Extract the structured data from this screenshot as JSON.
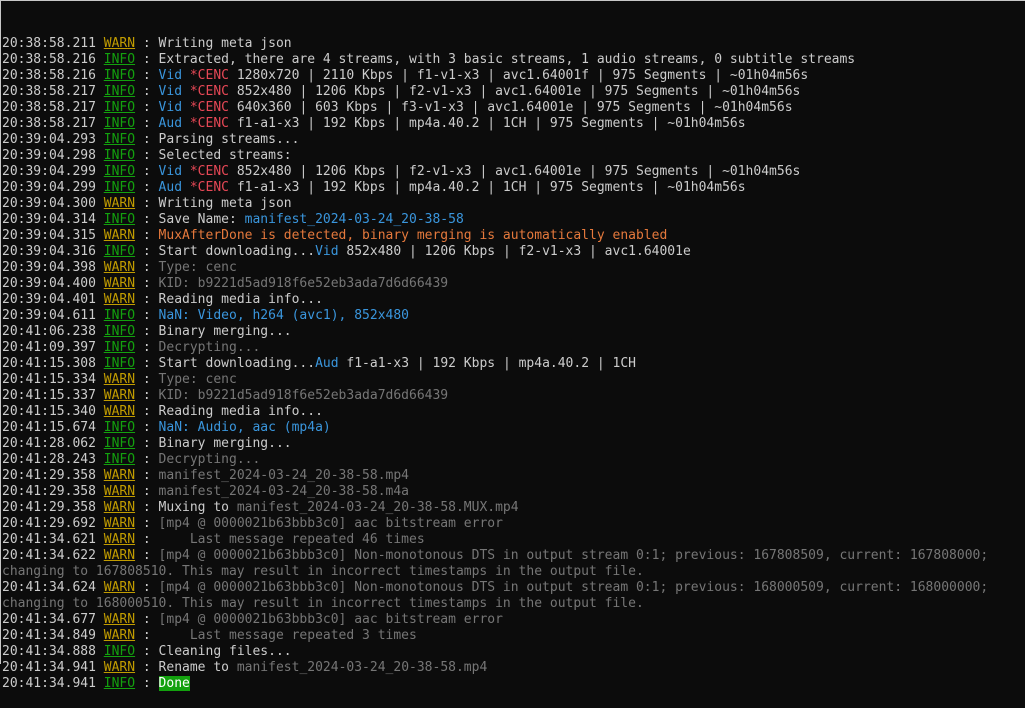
{
  "colors": {
    "background": "#0c0c0c",
    "text": "#cccccc",
    "warn": "#c19c00",
    "info": "#13a10e",
    "dim": "#767676",
    "cyan": "#3a96dd",
    "red": "#e74856",
    "orange": "#e5793c",
    "done_highlight": "#13a10e"
  },
  "lines": [
    {
      "time": "20:38:58.211",
      "level": "WARN",
      "parts": [
        {
          "t": "Writing meta json",
          "c": "default"
        }
      ]
    },
    {
      "time": "20:38:58.216",
      "level": "INFO",
      "parts": [
        {
          "t": "Extracted, there are 4 streams, with 3 basic streams, 1 audio streams, 0 subtitle streams",
          "c": "default"
        }
      ]
    },
    {
      "time": "20:38:58.216",
      "level": "INFO",
      "parts": [
        {
          "t": "Vid ",
          "c": "cyan"
        },
        {
          "t": "*CENC",
          "c": "red"
        },
        {
          "t": " 1280x720 | 2110 Kbps | f1-v1-x3 | avc1.64001f | 975 Segments | ~01h04m56s",
          "c": "default"
        }
      ]
    },
    {
      "time": "20:38:58.217",
      "level": "INFO",
      "parts": [
        {
          "t": "Vid ",
          "c": "cyan"
        },
        {
          "t": "*CENC",
          "c": "red"
        },
        {
          "t": " 852x480 | 1206 Kbps | f2-v1-x3 | avc1.64001e | 975 Segments | ~01h04m56s",
          "c": "default"
        }
      ]
    },
    {
      "time": "20:38:58.217",
      "level": "INFO",
      "parts": [
        {
          "t": "Vid ",
          "c": "cyan"
        },
        {
          "t": "*CENC",
          "c": "red"
        },
        {
          "t": " 640x360 | 603 Kbps | f3-v1-x3 | avc1.64001e | 975 Segments | ~01h04m56s",
          "c": "default"
        }
      ]
    },
    {
      "time": "20:38:58.217",
      "level": "INFO",
      "parts": [
        {
          "t": "Aud ",
          "c": "cyan"
        },
        {
          "t": "*CENC",
          "c": "red"
        },
        {
          "t": " f1-a1-x3 | 192 Kbps | mp4a.40.2 | 1CH | 975 Segments | ~01h04m56s",
          "c": "default"
        }
      ]
    },
    {
      "time": "20:39:04.293",
      "level": "INFO",
      "parts": [
        {
          "t": "Parsing streams...",
          "c": "default"
        }
      ]
    },
    {
      "time": "20:39:04.298",
      "level": "INFO",
      "parts": [
        {
          "t": "Selected streams:",
          "c": "default"
        }
      ]
    },
    {
      "time": "20:39:04.299",
      "level": "INFO",
      "parts": [
        {
          "t": "Vid ",
          "c": "cyan"
        },
        {
          "t": "*CENC",
          "c": "red"
        },
        {
          "t": " 852x480 | 1206 Kbps | f2-v1-x3 | avc1.64001e | 975 Segments | ~01h04m56s",
          "c": "default"
        }
      ]
    },
    {
      "time": "20:39:04.299",
      "level": "INFO",
      "parts": [
        {
          "t": "Aud ",
          "c": "cyan"
        },
        {
          "t": "*CENC",
          "c": "red"
        },
        {
          "t": " f1-a1-x3 | 192 Kbps | mp4a.40.2 | 1CH | 975 Segments | ~01h04m56s",
          "c": "default"
        }
      ]
    },
    {
      "time": "20:39:04.300",
      "level": "WARN",
      "parts": [
        {
          "t": "Writing meta json",
          "c": "default"
        }
      ]
    },
    {
      "time": "20:39:04.314",
      "level": "INFO",
      "parts": [
        {
          "t": "Save Name: ",
          "c": "default"
        },
        {
          "t": "manifest_2024-03-24_20-38-58",
          "c": "cyan"
        }
      ]
    },
    {
      "time": "20:39:04.315",
      "level": "WARN",
      "parts": [
        {
          "t": "MuxAfterDone is detected, binary merging is automatically enabled",
          "c": "orange"
        }
      ]
    },
    {
      "time": "20:39:04.316",
      "level": "INFO",
      "parts": [
        {
          "t": "Start downloading...",
          "c": "default"
        },
        {
          "t": "Vid",
          "c": "cyan"
        },
        {
          "t": " 852x480 | 1206 Kbps | f2-v1-x3 | avc1.64001e",
          "c": "default"
        }
      ]
    },
    {
      "time": "20:39:04.398",
      "level": "WARN",
      "parts": [
        {
          "t": "Type: cenc",
          "c": "gray"
        }
      ]
    },
    {
      "time": "20:39:04.400",
      "level": "WARN",
      "parts": [
        {
          "t": "KID: b9221d5ad918f6e52eb3ada7d6d66439",
          "c": "gray"
        }
      ]
    },
    {
      "time": "20:39:04.401",
      "level": "WARN",
      "parts": [
        {
          "t": "Reading media info...",
          "c": "default"
        }
      ]
    },
    {
      "time": "20:39:04.611",
      "level": "INFO",
      "parts": [
        {
          "t": "NaN: Video, h264 (avc1), 852x480",
          "c": "cyan"
        }
      ]
    },
    {
      "time": "20:41:06.238",
      "level": "INFO",
      "parts": [
        {
          "t": "Binary merging...",
          "c": "default"
        }
      ]
    },
    {
      "time": "20:41:09.397",
      "level": "INFO",
      "parts": [
        {
          "t": "Decrypting...",
          "c": "gray"
        }
      ]
    },
    {
      "time": "20:41:15.308",
      "level": "INFO",
      "parts": [
        {
          "t": "Start downloading...",
          "c": "default"
        },
        {
          "t": "Aud",
          "c": "cyan"
        },
        {
          "t": " f1-a1-x3 | 192 Kbps | mp4a.40.2 | 1CH",
          "c": "default"
        }
      ]
    },
    {
      "time": "20:41:15.334",
      "level": "WARN",
      "parts": [
        {
          "t": "Type: cenc",
          "c": "gray"
        }
      ]
    },
    {
      "time": "20:41:15.337",
      "level": "WARN",
      "parts": [
        {
          "t": "KID: b9221d5ad918f6e52eb3ada7d6d66439",
          "c": "gray"
        }
      ]
    },
    {
      "time": "20:41:15.340",
      "level": "WARN",
      "parts": [
        {
          "t": "Reading media info...",
          "c": "default"
        }
      ]
    },
    {
      "time": "20:41:15.674",
      "level": "INFO",
      "parts": [
        {
          "t": "NaN: Audio, aac (mp4a)",
          "c": "cyan"
        }
      ]
    },
    {
      "time": "20:41:28.062",
      "level": "INFO",
      "parts": [
        {
          "t": "Binary merging...",
          "c": "default"
        }
      ]
    },
    {
      "time": "20:41:28.243",
      "level": "INFO",
      "parts": [
        {
          "t": "Decrypting...",
          "c": "gray"
        }
      ]
    },
    {
      "time": "20:41:29.358",
      "level": "WARN",
      "parts": [
        {
          "t": "manifest_2024-03-24_20-38-58.mp4",
          "c": "gray"
        }
      ]
    },
    {
      "time": "20:41:29.358",
      "level": "WARN",
      "parts": [
        {
          "t": "manifest_2024-03-24_20-38-58.m4a",
          "c": "gray"
        }
      ]
    },
    {
      "time": "20:41:29.358",
      "level": "WARN",
      "parts": [
        {
          "t": "Muxing to ",
          "c": "default"
        },
        {
          "t": "manifest_2024-03-24_20-38-58.MUX.mp4",
          "c": "gray"
        }
      ]
    },
    {
      "time": "20:41:29.692",
      "level": "WARN",
      "parts": [
        {
          "t": "[mp4 @ 0000021b63bbb3c0] aac bitstream error",
          "c": "gray"
        }
      ]
    },
    {
      "time": "20:41:34.621",
      "level": "WARN",
      "parts": [
        {
          "t": "    Last message repeated 46 times",
          "c": "gray"
        }
      ]
    },
    {
      "time": "20:41:34.622",
      "level": "WARN",
      "parts": [
        {
          "t": "[mp4 @ 0000021b63bbb3c0] Non-monotonous DTS in output stream 0:1; previous: 167808509, current: 167808000;",
          "c": "gray"
        }
      ]
    },
    {
      "raw": "changing to 167808510. This may result in incorrect timestamps in the output file."
    },
    {
      "time": "20:41:34.624",
      "level": "WARN",
      "parts": [
        {
          "t": "[mp4 @ 0000021b63bbb3c0] Non-monotonous DTS in output stream 0:1; previous: 168000509, current: 168000000;",
          "c": "gray"
        }
      ]
    },
    {
      "raw": "changing to 168000510. This may result in incorrect timestamps in the output file."
    },
    {
      "time": "20:41:34.677",
      "level": "WARN",
      "parts": [
        {
          "t": "[mp4 @ 0000021b63bbb3c0] aac bitstream error",
          "c": "gray"
        }
      ]
    },
    {
      "time": "20:41:34.849",
      "level": "WARN",
      "parts": [
        {
          "t": "    Last message repeated 3 times",
          "c": "gray"
        }
      ]
    },
    {
      "time": "20:41:34.888",
      "level": "INFO",
      "parts": [
        {
          "t": "Cleaning files...",
          "c": "default"
        }
      ]
    },
    {
      "time": "20:41:34.941",
      "level": "WARN",
      "parts": [
        {
          "t": "Rename to ",
          "c": "default"
        },
        {
          "t": "manifest_2024-03-24_20-38-58.mp4",
          "c": "gray"
        }
      ]
    },
    {
      "time": "20:41:34.941",
      "level": "INFO",
      "parts": [
        {
          "t": "Done",
          "c": "done"
        }
      ]
    }
  ]
}
